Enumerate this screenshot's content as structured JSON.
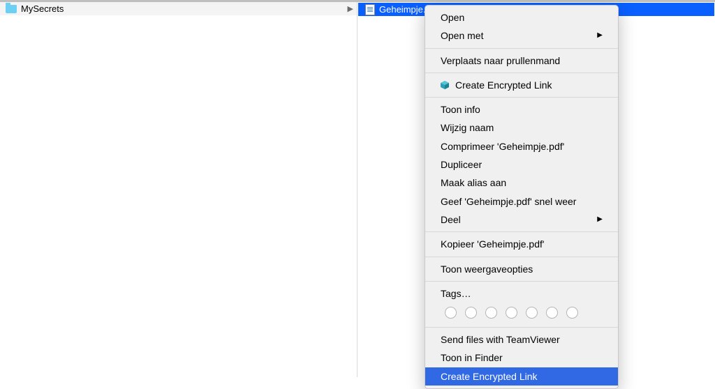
{
  "column1": {
    "folder_label": "MySecrets"
  },
  "column2": {
    "file_label": "Geheimpje.pdf"
  },
  "menu": {
    "open": "Open",
    "open_with": "Open met",
    "trash": "Verplaats naar prullenmand",
    "create_encrypted_top": "Create Encrypted Link",
    "show_info": "Toon info",
    "rename": "Wijzig naam",
    "compress": "Comprimeer 'Geheimpje.pdf'",
    "duplicate": "Dupliceer",
    "alias": "Maak alias aan",
    "quicklook": "Geef 'Geheimpje.pdf' snel weer",
    "share": "Deel",
    "copy": "Kopieer 'Geheimpje.pdf'",
    "viewopts": "Toon weergaveopties",
    "tags": "Tags…",
    "teamviewer": "Send files with TeamViewer",
    "show_in_finder": "Toon in Finder",
    "create_encrypted_bottom": "Create Encrypted Link"
  }
}
